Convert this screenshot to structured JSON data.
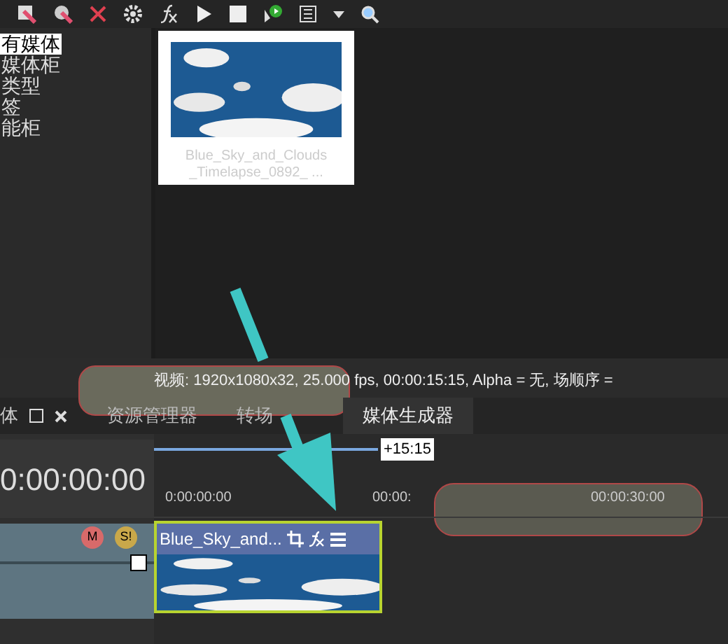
{
  "sidebar": {
    "items": [
      {
        "label": "有媒体",
        "selected": true
      },
      {
        "label": "媒体柜",
        "selected": false
      },
      {
        "label": "类型",
        "selected": false
      },
      {
        "label": "签",
        "selected": false
      },
      {
        "label": "能柜",
        "selected": false
      }
    ]
  },
  "media": {
    "items": [
      {
        "caption": "Blue_Sky_and_Clouds _Timelapse_0892_ ..."
      }
    ]
  },
  "status_text": "视频: 1920x1080x32, 25.000 fps, 00:00:15:15, Alpha = 无, 场顺序 =",
  "dock": {
    "cut_label": "体",
    "tabs": [
      {
        "label": "资源管理器",
        "selected": false
      },
      {
        "label": "转场",
        "selected": false
      },
      {
        "label": "媒体生成器",
        "selected": true
      }
    ]
  },
  "timeline": {
    "timecode": "0:00:00:00",
    "loop_length": "+15:15",
    "ruler_labels": [
      "0:00:00:00",
      "00:00:",
      "00:00:30:00"
    ],
    "track": {
      "mute_label": "M",
      "solo_label": "S!",
      "level": 0.95
    },
    "clip": {
      "name": "Blue_Sky_and..."
    }
  }
}
